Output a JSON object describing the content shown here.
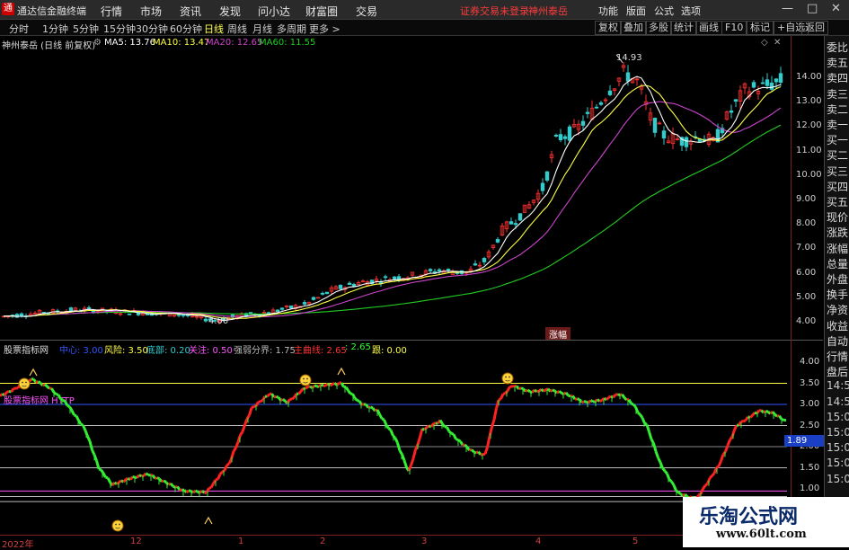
{
  "app": {
    "title": "通达信金融终端"
  },
  "menu": [
    "行情",
    "市场",
    "资讯",
    "发现",
    "问小达",
    "财富圈",
    "交易"
  ],
  "promo": [
    "证券交易未登录",
    "神州泰岳"
  ],
  "right_menu": [
    "功能",
    "版面",
    "公式",
    "选项"
  ],
  "window_buttons": [
    "—",
    "□",
    "✕"
  ],
  "periods": [
    "分时",
    "1分钟",
    "5分钟",
    "15分钟",
    "30分钟",
    "60分钟",
    "日线",
    "周线",
    "月线",
    "多周期",
    "更多 >"
  ],
  "active_period": "日线",
  "tools": [
    "复权",
    "叠加",
    "多股",
    "统计",
    "画线",
    "F10",
    "标记",
    "+自选",
    "返回"
  ],
  "main_legend": {
    "stock": "神州泰岳 (日线 前复权)",
    "ma5": "MA5: 13.76",
    "ma10": "MA10: 13.47",
    "ma20": "MA20: 12.65",
    "ma60": "MA60: 11.55"
  },
  "colors": {
    "ma5": "#ffffff",
    "ma10": "#ffff44",
    "ma20": "#cc44cc",
    "ma60": "#22cc22",
    "up": "#ff3333",
    "down": "#33cccc"
  },
  "price_axis": [
    "14.00",
    "13.00",
    "12.00",
    "11.00",
    "10.00",
    "9.00",
    "8.00",
    "7.00",
    "6.00",
    "5.00",
    "4.00"
  ],
  "price_annot": {
    "high": "14.93",
    "low": "4.00"
  },
  "zhang_badge": "涨幅",
  "right_panel": [
    "委比",
    "卖五",
    "卖四",
    "卖三",
    "卖二",
    "卖一",
    "买一",
    "买二",
    "买三",
    "买四",
    "买五",
    "现价",
    "涨跌",
    "涨幅",
    "总量",
    "外盘",
    "换手",
    "净资",
    "收益",
    "自动",
    "行情",
    "盘后",
    "14:5",
    "14:5",
    "15:0",
    "15:0",
    "15:0",
    "15:0",
    "15:0"
  ],
  "ind_legend": {
    "name": "股票指标网",
    "zhongxin": "中心: 3.00",
    "fengxian": "风险: 3.50",
    "dibu": "底部: 0.20",
    "guanzhu": "关注: 0.50",
    "qiangruo": "强弱分界: 1.75",
    "zhuxian": "主曲线: 2.65",
    "zhuxian2": ": 2.65",
    "gen": "跟: 0.00"
  },
  "ind_axis": [
    "4.00",
    "3.50",
    "3.00",
    "2.50",
    "2.00",
    "1.50",
    "1.00"
  ],
  "ind_label": "股票指标网 HTTP",
  "ind_low_value": "1.89",
  "dates": [
    "2022年",
    "12",
    "1",
    "2",
    "3",
    "4",
    "5"
  ],
  "watermark": {
    "title": "乐淘公式网",
    "url": "www.60lt.com"
  }
}
